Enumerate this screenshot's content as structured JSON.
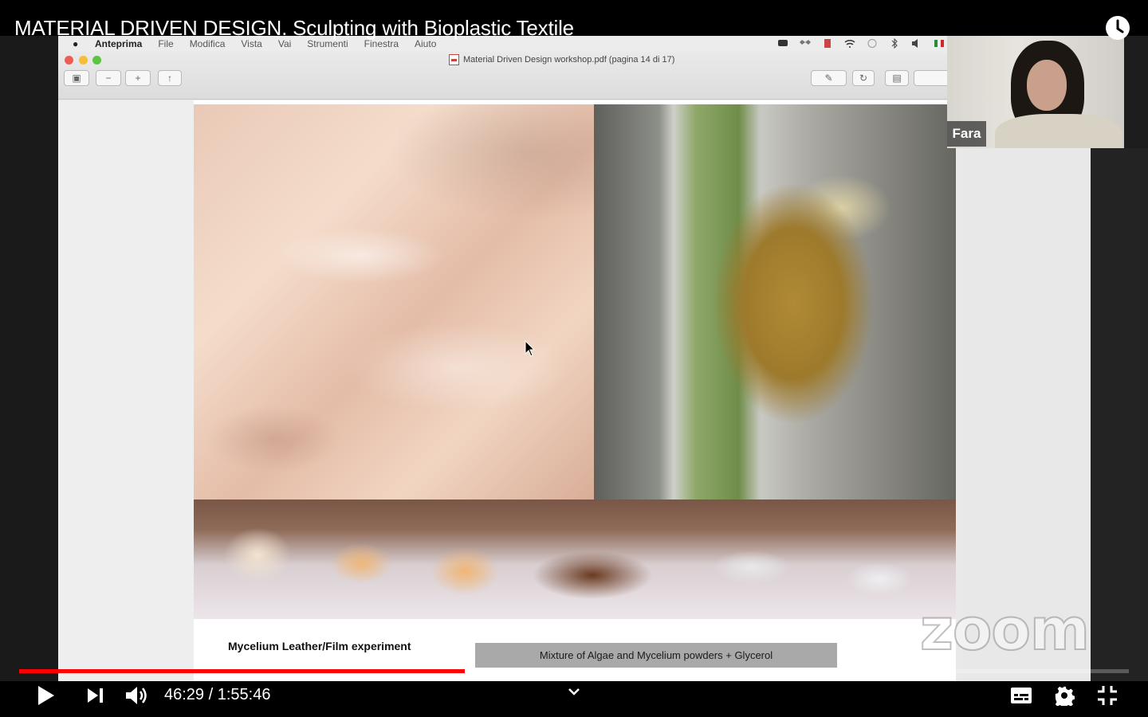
{
  "video": {
    "title": "MATERIAL DRIVEN DESIGN. Sculpting with Bioplastic Textile",
    "current_time": "46:29",
    "separator": "/",
    "duration": "1:55:46",
    "progress_fraction": 0.4016,
    "loaded_fraction": 0.405,
    "accent_color": "#ff0000"
  },
  "mac_menubar": {
    "items": [
      "Anteprima",
      "File",
      "Modifica",
      "Vista",
      "Vai",
      "Strumenti",
      "Finestra",
      "Aiuto"
    ]
  },
  "preview_window": {
    "document_title": "Material Driven Design workshop.pdf (pagina 14 di 17)"
  },
  "slide": {
    "caption_title": "Mycelium Leather/Film experiment",
    "caption_box": "Mixture of Algae and Mycelium powders + Glycerol"
  },
  "zoom": {
    "participant_name": "Fara",
    "watermark": "zoom"
  },
  "icons": {
    "play": "play-icon",
    "next": "next-icon",
    "volume": "volume-icon",
    "subtitles": "subtitles-icon",
    "settings": "gear-icon",
    "exit_fullscreen": "exit-fullscreen-icon",
    "watch_later": "clock-icon",
    "chevron": "chevron-down-icon"
  }
}
